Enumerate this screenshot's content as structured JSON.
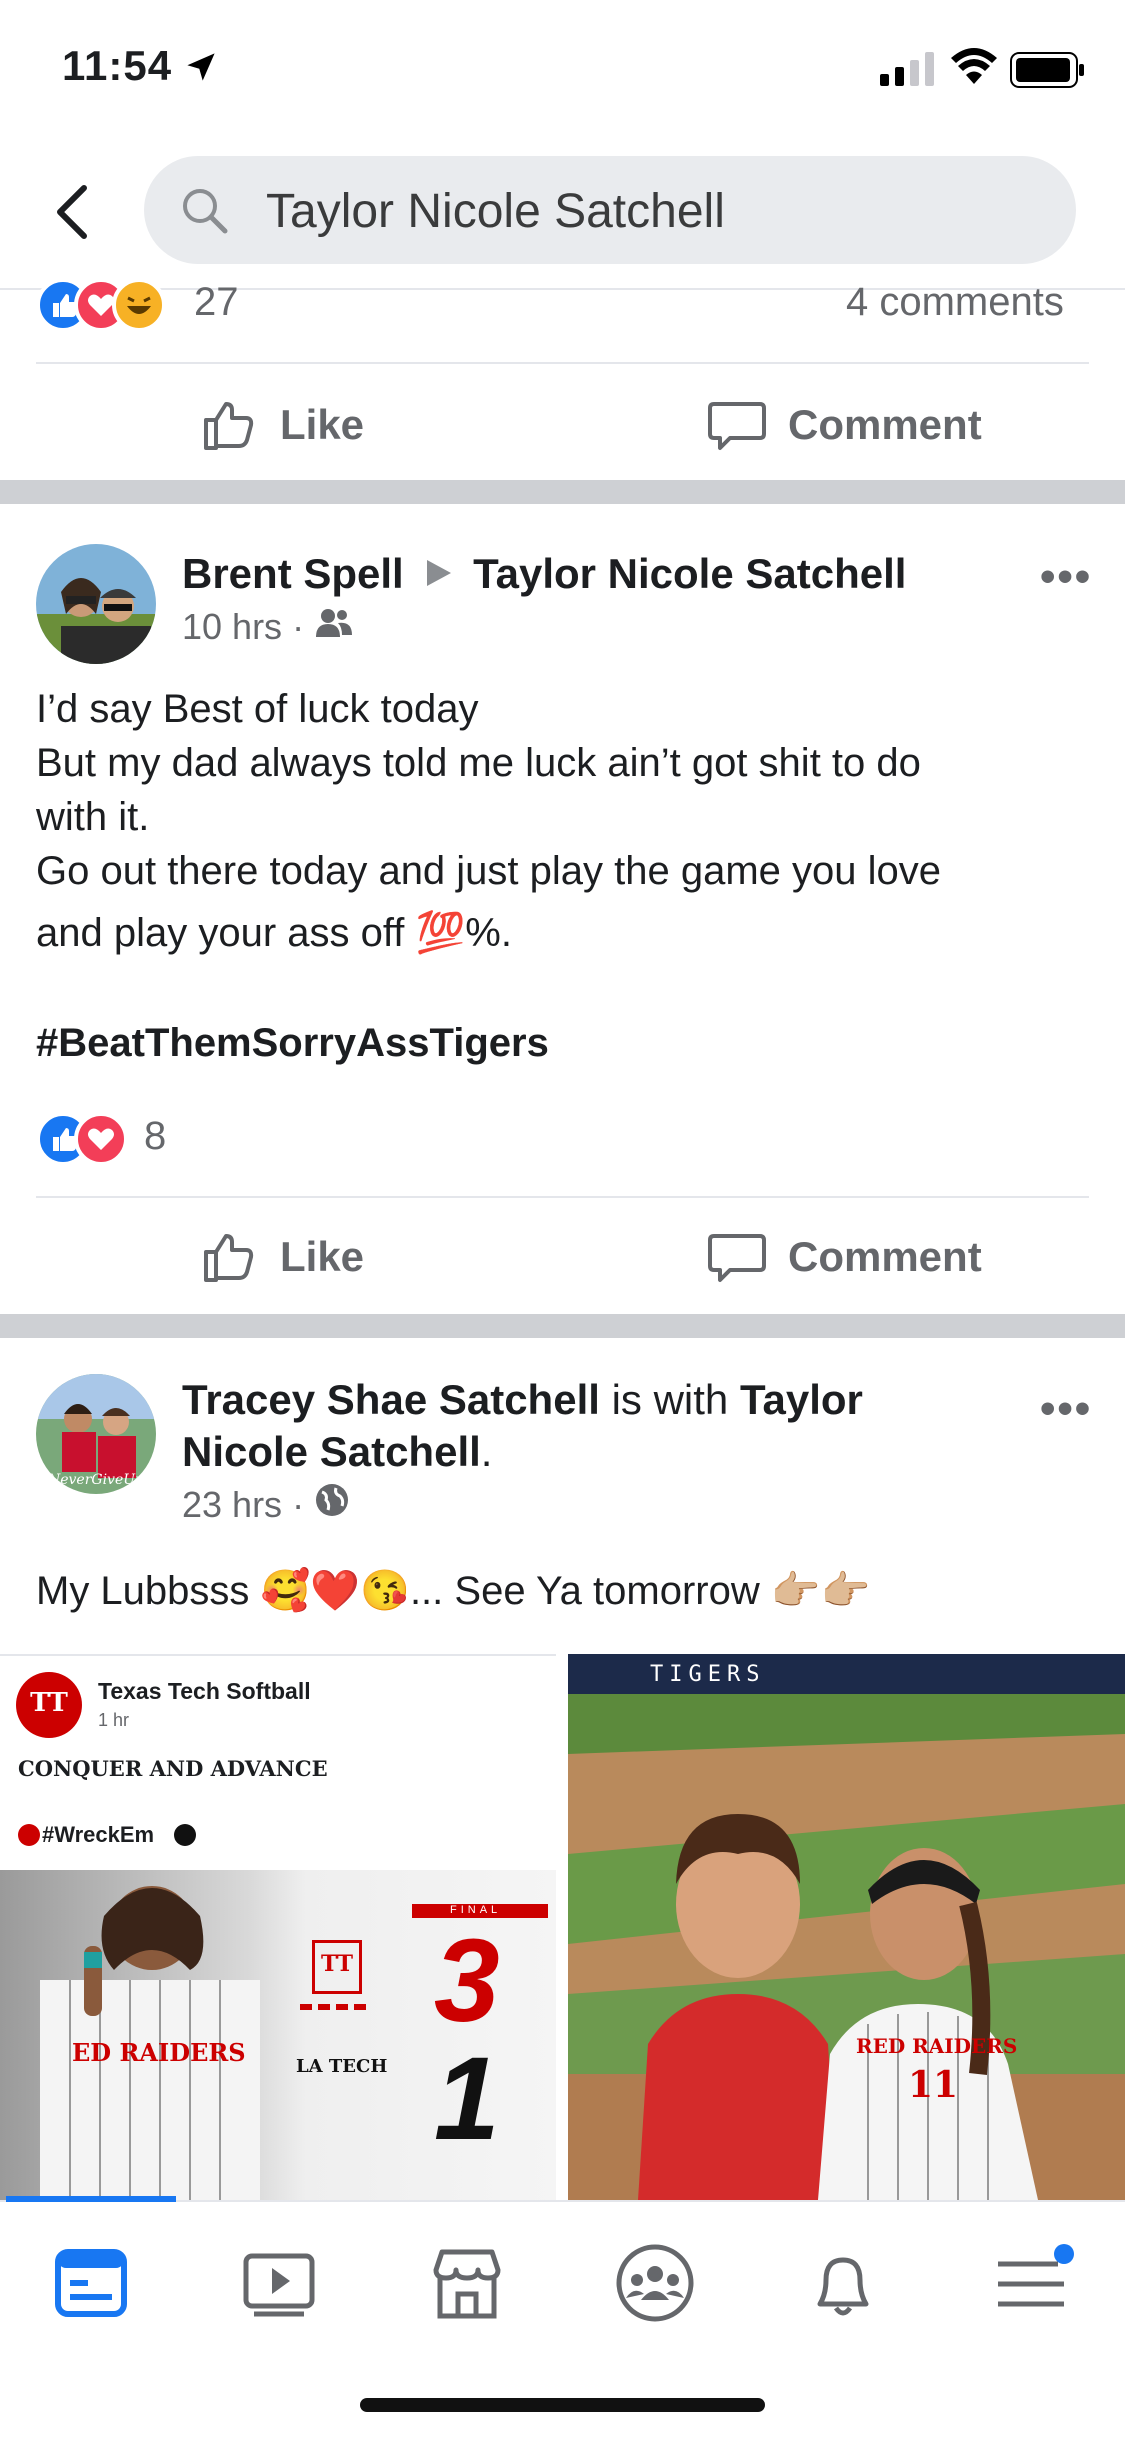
{
  "status_bar": {
    "time": "11:54",
    "location_icon": "location-arrow-icon"
  },
  "search": {
    "query": "Taylor Nicole Satchell"
  },
  "post_prev": {
    "reaction_count": "27",
    "comments": "4 comments",
    "like_label": "Like",
    "comment_label": "Comment"
  },
  "post1": {
    "author": "Brent Spell",
    "target": "Taylor Nicole Satchell",
    "time": "10 hrs",
    "privacy_icon": "friends-icon",
    "lines": [
      "I’d say Best of luck today",
      "But my dad always told me luck ain’t got shit to do",
      "with it.",
      "Go out there today and just play the game you love",
      "and play your ass off 💯%."
    ],
    "hashtag": "#BeatThemSorryAssTigers",
    "reaction_count": "8",
    "like_label": "Like",
    "comment_label": "Comment"
  },
  "post2": {
    "author": "Tracey Shae Satchell",
    "with_text": " is with ",
    "tagged_line1": "Taylor",
    "tagged_line2": "Nicole Satchell",
    "period": ".",
    "time": "23 hrs",
    "privacy_icon": "globe-icon",
    "text": "My Lubbsss 🥰❤️😘... See Ya tomorrow 👉🏼👉🏼",
    "image1": {
      "page": "Texas Tech Softball",
      "time": "1 hr",
      "headline": "CONQUER AND ADVANCE",
      "tag": "#WreckEm",
      "score_label": "FINAL",
      "score_home": "3",
      "score_away": "1",
      "jersey_text": "ED RAIDERS",
      "away_logo": "LA TECH",
      "logo_tt": "TT"
    },
    "image2": {
      "banner": "TIGERS",
      "jersey_text": "RED RAIDERS",
      "jersey_num": "11"
    }
  },
  "colors": {
    "like_blue": "#1877f2",
    "love_red": "#f33e58",
    "haha_yellow": "#f7b125",
    "tt_red": "#cc0000"
  }
}
